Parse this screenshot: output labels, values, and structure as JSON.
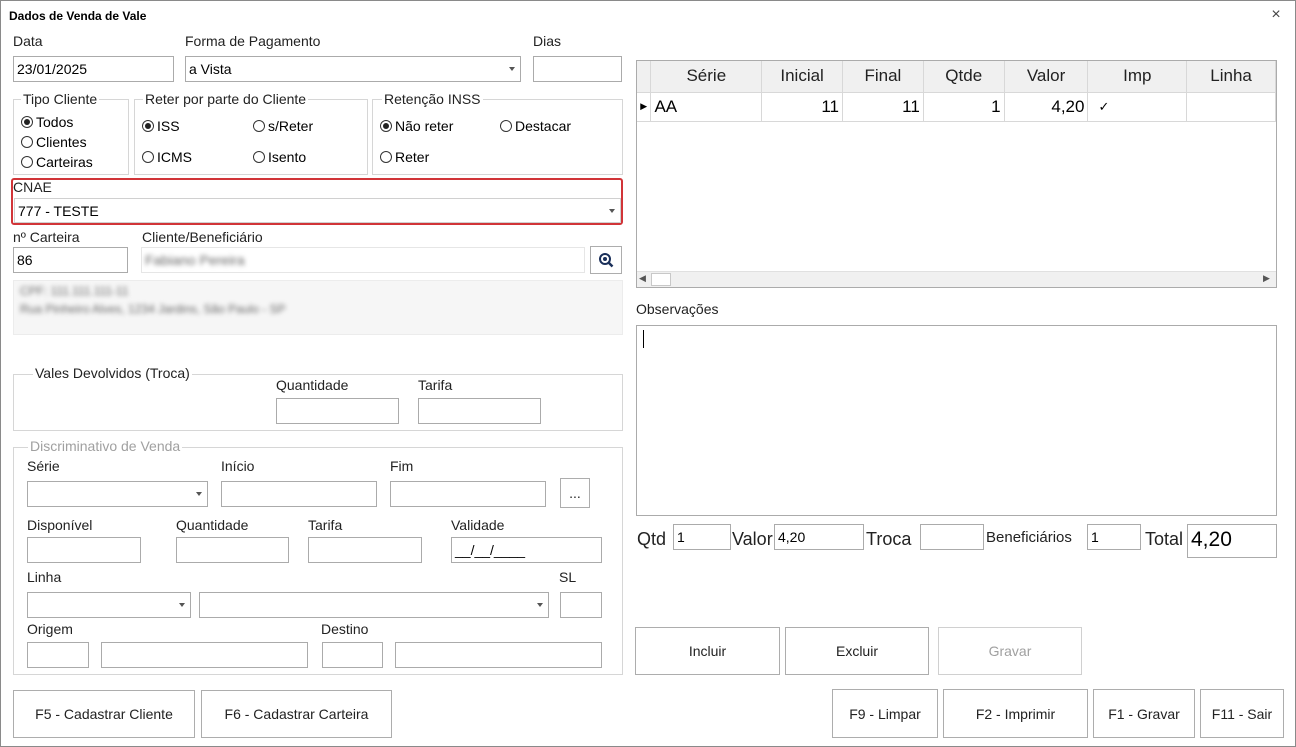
{
  "window": {
    "title": "Dados de Venda de Vale",
    "close": "×"
  },
  "labels": {
    "data": "Data",
    "forma": "Forma de Pagamento",
    "dias": "Dias",
    "tipo_cliente": "Tipo Cliente",
    "reter": "Reter por parte do Cliente",
    "retencao_inss": "Retenção INSS",
    "cnae": "CNAE",
    "carteira": "nº Carteira",
    "cliente": "Cliente/Beneficiário",
    "vales_devolvidos": "Vales Devolvidos (Troca)",
    "quantidade": "Quantidade",
    "tarifa": "Tarifa",
    "discriminativo": "Discriminativo de Venda",
    "serie": "Série",
    "inicio": "Início",
    "fim": "Fim",
    "disponivel": "Disponível",
    "validade": "Validade",
    "linha": "Linha",
    "sl": "SL",
    "origem": "Origem",
    "destino": "Destino",
    "observacoes": "Observações",
    "qtd": "Qtd",
    "valor": "Valor",
    "troca": "Troca",
    "beneficiarios": "Beneficiários",
    "total": "Total"
  },
  "values": {
    "data": "23/01/2025",
    "forma": "a Vista",
    "cnae": "777 - TESTE",
    "carteira": "86",
    "cliente_blurred": "Fabiano Pereira",
    "address_line1": "CPF: 111.111.111-11",
    "address_line2": "Rua Pinheiro Alves, 1234 Jardins, São Paulo - SP",
    "validade": "__/__/____",
    "ellipsis": "...",
    "qtd": "1",
    "valor": "4,20",
    "beneficiarios": "1",
    "total": "4,20"
  },
  "radios": {
    "todos": "Todos",
    "clientes": "Clientes",
    "carteiras": "Carteiras",
    "iss": "ISS",
    "s_reter": "s/Reter",
    "icms": "ICMS",
    "isento": "Isento",
    "nao_reter": "Não reter",
    "destacar": "Destacar",
    "reter": "Reter"
  },
  "grid": {
    "columns": [
      "Série",
      "Inicial",
      "Final",
      "Qtde",
      "Valor",
      "Imp",
      "Linha"
    ],
    "rows": [
      {
        "serie": "AA",
        "inicial": "11",
        "final": "11",
        "qtde": "1",
        "valor": "4,20",
        "imp": "✓",
        "linha": ""
      }
    ]
  },
  "buttons": {
    "incluir": "Incluir",
    "excluir": "Excluir",
    "gravar": "Gravar",
    "f5": "F5 - Cadastrar Cliente",
    "f6": "F6 - Cadastrar Carteira",
    "f9": "F9 - Limpar",
    "f2": "F2 - Imprimir",
    "f1": "F1 - Gravar",
    "f11": "F11 - Sair"
  },
  "colors": {
    "focus_border": "#d13438",
    "header_bg": "#f0f0f0",
    "border": "#ababab"
  }
}
